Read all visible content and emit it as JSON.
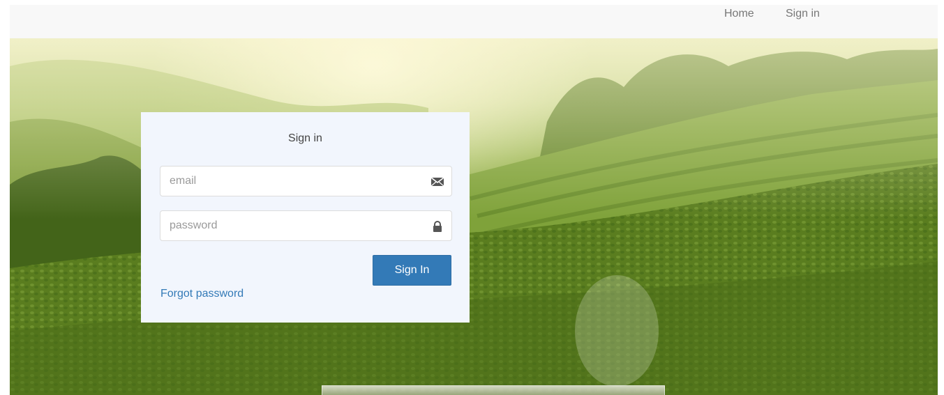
{
  "nav": {
    "home_label": "Home",
    "signin_label": "Sign in"
  },
  "login": {
    "title": "Sign in",
    "email_placeholder": "email",
    "email_icon": "envelope-icon",
    "password_placeholder": "password",
    "password_icon": "lock-icon",
    "submit_label": "Sign In",
    "forgot_label": "Forgot password"
  },
  "colors": {
    "primary": "#337ab7",
    "navbar_bg": "#f8f8f8",
    "card_bg": "#f2f6fd"
  }
}
